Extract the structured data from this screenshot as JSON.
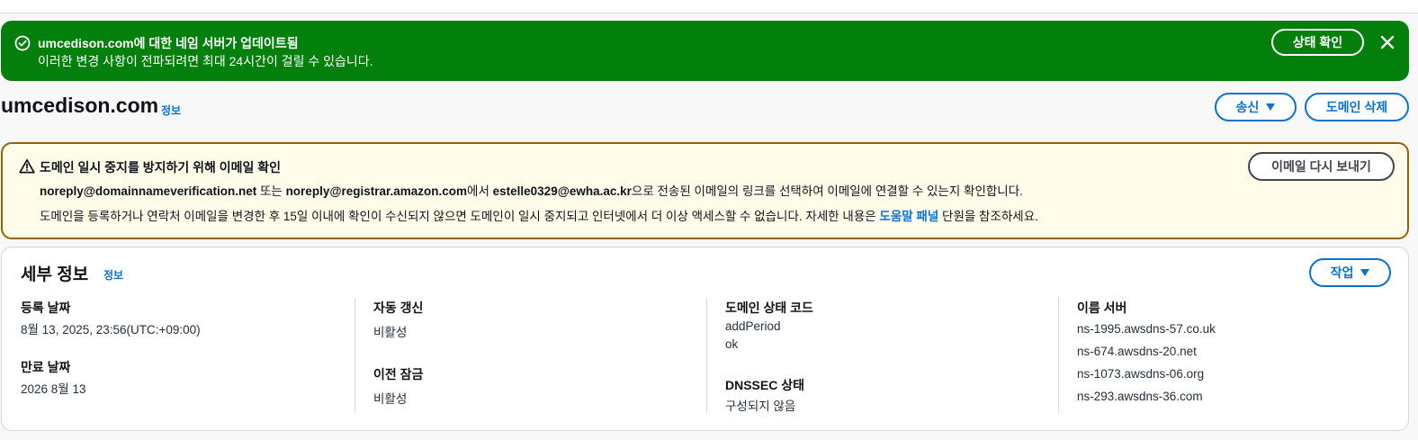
{
  "flash": {
    "title": "umcedison.com에 대한 네임 서버가 업데이트됨",
    "body": "이러한 변경 사항이 전파되려면 최대 24시간이 걸릴 수 있습니다.",
    "button": "상태 확인",
    "status_color": "#037f0c"
  },
  "header": {
    "domain": "umcedison.com",
    "info": "정보",
    "send_button": "송신",
    "delete_button": "도메인 삭제"
  },
  "warning": {
    "title": "도메인 일시 중지를 방지하기 위해 이메일 확인",
    "line1": {
      "email1": "noreply@domainnameverification.net",
      "or": " 또는 ",
      "email2": "noreply@registrar.amazon.com",
      "from": "에서 ",
      "user_email": "estelle0329@ewha.ac.kr",
      "rest": "으로 전송된 이메일의 링크를 선택하여 이메일에 연결할 수 있는지 확인합니다."
    },
    "line2": {
      "text": "도메인을 등록하거나 연락처 이메일을 변경한 후 15일 이내에 확인이 수신되지 않으면 도메인이 일시 중지되고 인터넷에서 더 이상 액세스할 수 없습니다. 자세한 내용은 ",
      "link": "도움말 패널",
      "after": " 단원을 참조하세요."
    },
    "button": "이메일 다시 보내기",
    "border_color": "#8d6605"
  },
  "details": {
    "title": "세부 정보",
    "info": "정보",
    "actions_button": "작업",
    "registration_date_label": "등록 날짜",
    "registration_date": "8월 13, 2025, 23:56(UTC:+09:00)",
    "expiration_date_label": "만료 날짜",
    "expiration_date": "2026 8월 13",
    "auto_renew_label": "자동 갱신",
    "auto_renew": "비활성",
    "transfer_lock_label": "이전 잠금",
    "transfer_lock": "비활성",
    "status_code_label": "도메인 상태 코드",
    "status_codes": [
      "addPeriod",
      "ok"
    ],
    "dnssec_label": "DNSSEC 상태",
    "dnssec": "구성되지 않음",
    "name_servers_label": "이름 서버",
    "name_servers": [
      "ns-1995.awsdns-57.co.uk",
      "ns-674.awsdns-20.net",
      "ns-1073.awsdns-06.org",
      "ns-293.awsdns-36.com"
    ]
  },
  "accent_color": "#0972d3"
}
